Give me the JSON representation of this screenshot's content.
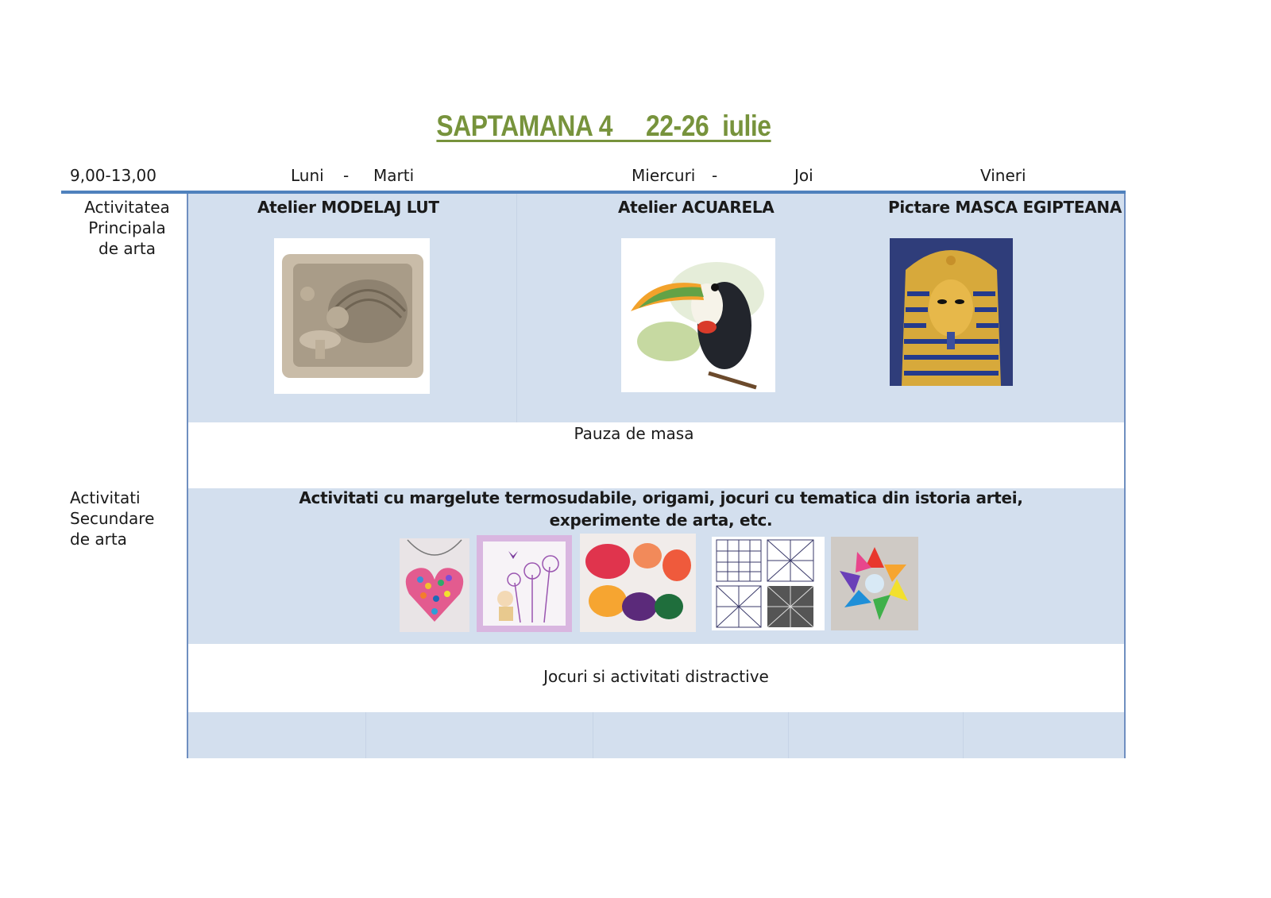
{
  "title": "SAPTAMANA 4     22-26  iulie",
  "header": {
    "time": "9,00-13,00",
    "day1": "Luni",
    "dash1": "-",
    "day2": "Marti",
    "day3": "Miercuri",
    "dash2": "-",
    "day4": "Joi",
    "day5": "Vineri"
  },
  "main_activity": {
    "label_line1": "Activitatea",
    "label_line2": "Principala",
    "label_line3": "de arta",
    "workshops": [
      {
        "title": "Atelier  MODELAJ LUT",
        "image": "clay-hedgehog-relief"
      },
      {
        "title": "Atelier ACUARELA",
        "image": "watercolor-toucan"
      },
      {
        "title": "Pictare MASCA EGIPTEANA",
        "image": "egyptian-pharaoh-mask"
      }
    ]
  },
  "lunch": "Pauza de masa",
  "secondary_activity": {
    "label_line1": "Activitati",
    "label_line2": "Secundare",
    "label_line3": "de arta",
    "description_line1": "Activitati cu margelute termosudabile, origami, jocuri cu tematica din istoria artei,",
    "description_line2": "experimente de arta, etc.",
    "images": [
      "bead-heart",
      "embroidered-card",
      "melted-crayons",
      "zentangle-patterns",
      "origami-star"
    ]
  },
  "games": "Jocuri si activitati distractive",
  "colors": {
    "title": "#77933c",
    "band": "#d3dfee",
    "rule": "#4f81bd"
  }
}
